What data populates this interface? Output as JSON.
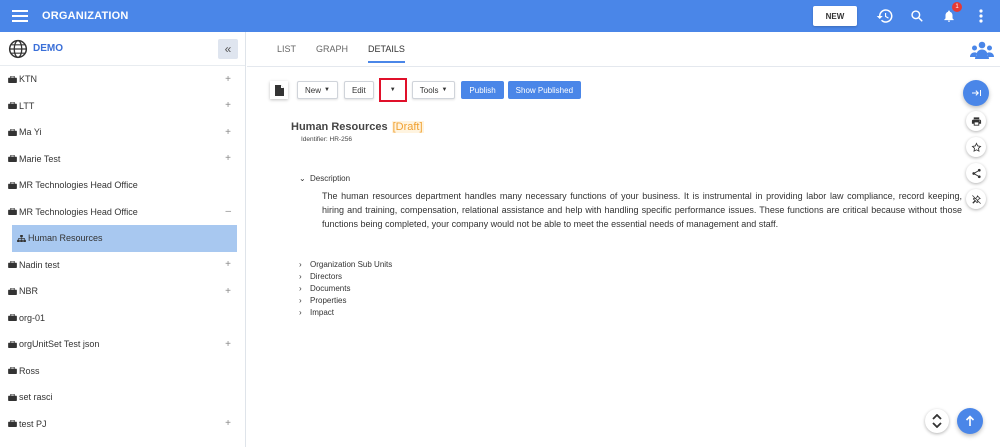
{
  "topbar": {
    "title": "ORGANIZATION",
    "new_label": "NEW",
    "notification_count": "1",
    "accent": "#4a86e8"
  },
  "sidebar": {
    "org_name": "DEMO",
    "collapse_label": "«",
    "items": [
      {
        "label": "KTN",
        "toggle": "+"
      },
      {
        "label": "LTT",
        "toggle": "+"
      },
      {
        "label": "Ma Yi",
        "toggle": "+"
      },
      {
        "label": "Marie Test",
        "toggle": "+"
      },
      {
        "label": "MR Technologies Head Office",
        "toggle": ""
      },
      {
        "label": "MR Technologies Head Office",
        "toggle": "–"
      },
      {
        "label": "Human Resources",
        "toggle": "",
        "selected": true
      },
      {
        "label": "Nadin test",
        "toggle": "+"
      },
      {
        "label": "NBR",
        "toggle": "+"
      },
      {
        "label": "org-01",
        "toggle": ""
      },
      {
        "label": "orgUnitSet Test json",
        "toggle": "+"
      },
      {
        "label": "Ross",
        "toggle": ""
      },
      {
        "label": "set rasci",
        "toggle": ""
      },
      {
        "label": "test PJ",
        "toggle": "+"
      }
    ]
  },
  "tabs": [
    {
      "label": "LIST"
    },
    {
      "label": "GRAPH"
    },
    {
      "label": "DETAILS",
      "active": true
    }
  ],
  "toolbar": {
    "new_label": "New",
    "edit_label": "Edit",
    "tools_label": "Tools",
    "publish_label": "Publish",
    "show_published_label": "Show Published"
  },
  "details": {
    "title": "Human Resources",
    "status": "[Draft]",
    "identifier": "Identifier:  HR-256",
    "description_label": "Description",
    "description_text": "The human resources department handles many necessary functions of your business. It is instrumental in providing labor law compliance, record keeping, hiring and training, compensation, relational assistance and help with handling specific performance issues. These functions are critical because without those functions being completed, your company would not be able to meet the essential needs of management and staff.",
    "sections": [
      {
        "label": "Organization Sub Units"
      },
      {
        "label": "Directors"
      },
      {
        "label": "Documents"
      },
      {
        "label": "Properties"
      },
      {
        "label": "Impact"
      }
    ]
  },
  "icons": {
    "menu": "hamburger-icon",
    "history": "history-icon",
    "search": "search-icon",
    "bell": "bell-icon",
    "more": "more-vert-icon",
    "globe": "globe-icon",
    "people": "people-icon",
    "print": "print-icon",
    "star": "star-icon",
    "share": "share-icon",
    "pin": "pin-off-icon",
    "up": "arrow-up-icon"
  }
}
